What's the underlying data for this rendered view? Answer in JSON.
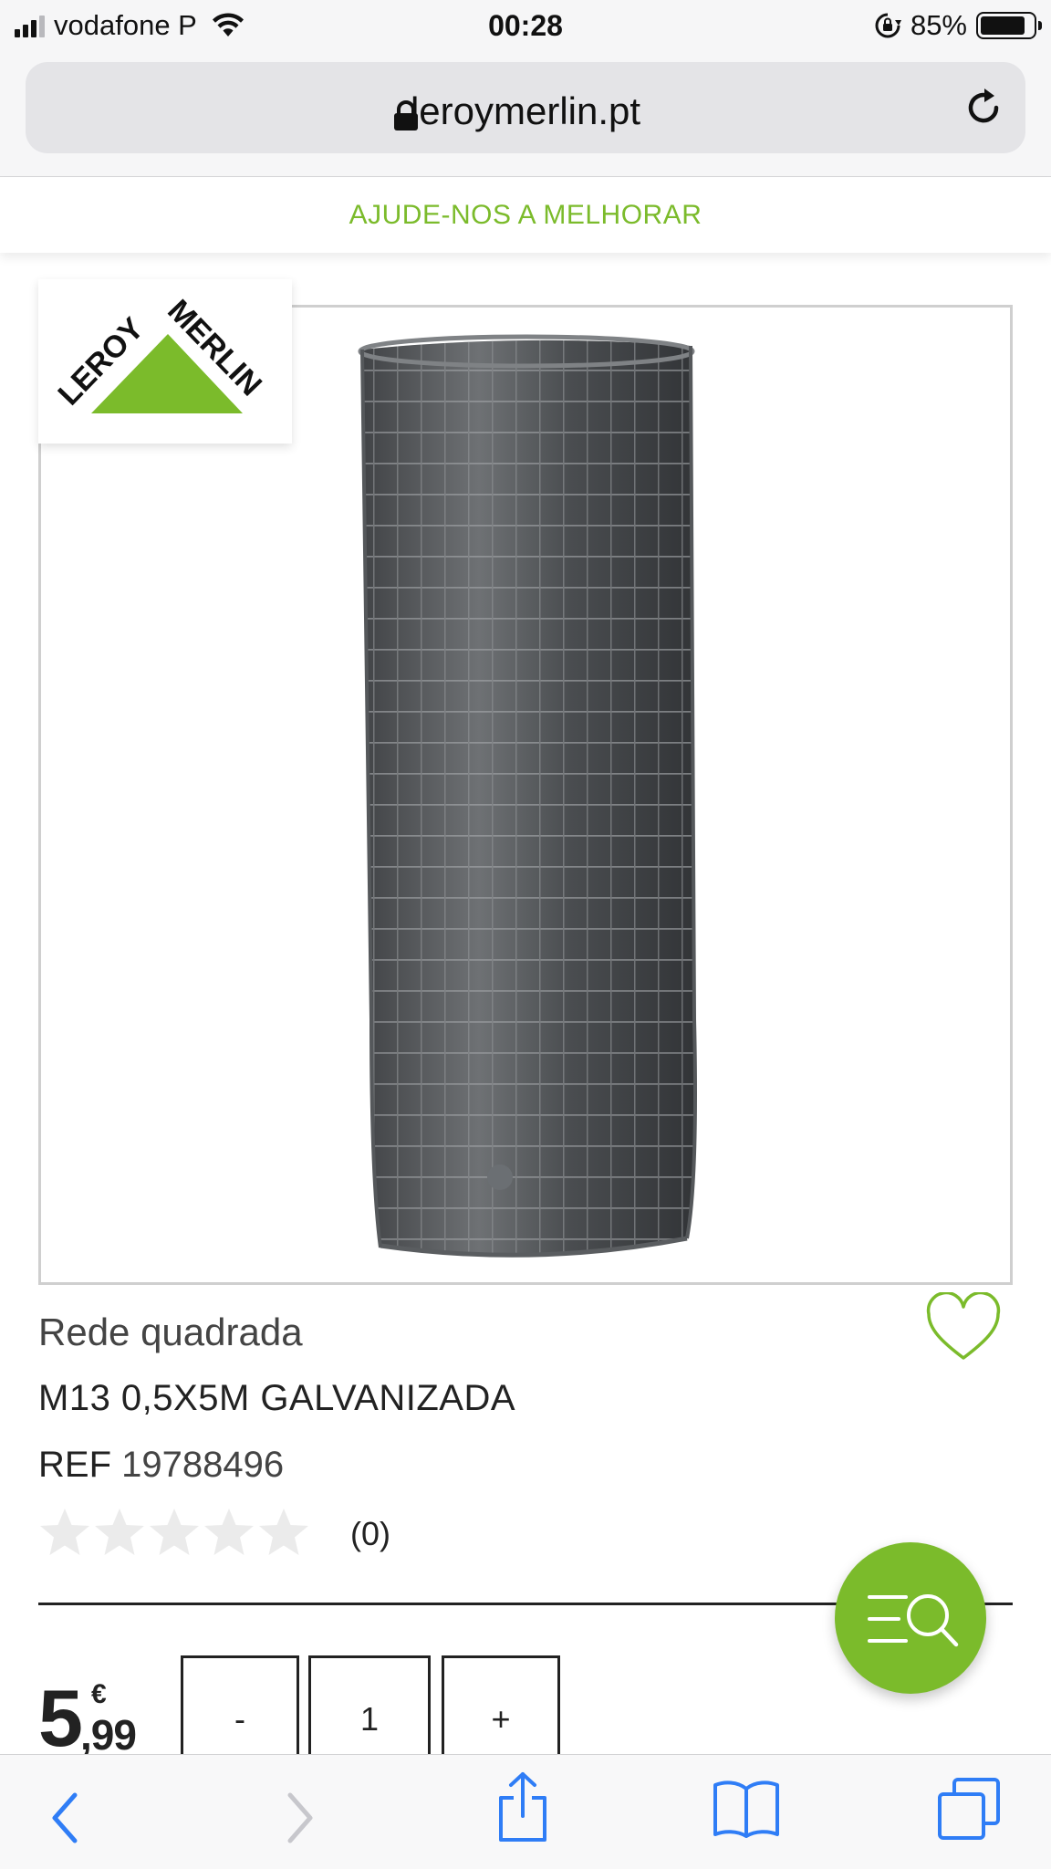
{
  "status_bar": {
    "carrier": "vodafone P",
    "time": "00:28",
    "battery_percent": "85%",
    "battery_level": 0.85,
    "signal_bars": 3,
    "signal_bars_total": 4,
    "icons": [
      "signal-icon",
      "wifi-icon",
      "orientation-lock-icon",
      "battery-icon"
    ]
  },
  "browser": {
    "url": "leroymerlin.pt",
    "icons": [
      "lock-icon",
      "reload-icon"
    ]
  },
  "feedback": {
    "label": "AJUDE-NOS A MELHORAR"
  },
  "brand": {
    "logo_text": "LEROY MERLIN",
    "primary_color": "#7bbb2b",
    "text_color": "#111111"
  },
  "gallery": {
    "image_subject": "galvanized square wire mesh roll",
    "dot_count": 1,
    "active_dot": 0
  },
  "product": {
    "category": "Rede quadrada",
    "name": "M13 0,5X5M GALVANIZADA",
    "ref_label": "REF",
    "ref_number": "19788496",
    "rating_value": 0,
    "rating_max": 5,
    "rating_count": "(0)",
    "favorite_icon": "heart-outline-icon"
  },
  "price": {
    "integer": "5",
    "currency": "€",
    "decimal": ",99"
  },
  "quantity": {
    "minus_label": "-",
    "value": "1",
    "plus_label": "+"
  },
  "fab": {
    "icon": "menu-search-icon",
    "color": "#7bbb2b"
  },
  "toolbar": {
    "icons": [
      "back-icon",
      "forward-icon",
      "share-icon",
      "bookmarks-icon",
      "tabs-icon"
    ],
    "accent_color": "#2f7df6",
    "disabled_color": "#c7c7cc"
  }
}
